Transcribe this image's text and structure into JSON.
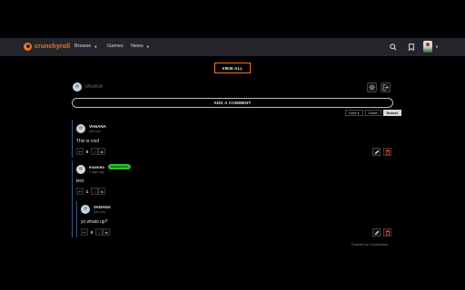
{
  "nav": {
    "logo": "crunchyroll",
    "items": [
      {
        "label": "Browse",
        "caret": true
      },
      {
        "label": "Games",
        "caret": false
      },
      {
        "label": "News",
        "caret": true
      }
    ],
    "icons": [
      "search-icon",
      "bookmark-icon",
      "avatar"
    ],
    "accent": "#f47521",
    "bg": "#23252b"
  },
  "view_all": "VIEW ALL",
  "composer": {
    "username": "VANANA",
    "add_comment": "ADD A COMMENT",
    "icons": [
      "gear-icon",
      "logout-icon"
    ]
  },
  "sort": {
    "options": [
      "Votes ▾",
      "Oldest",
      "Newest"
    ],
    "active": "Newest"
  },
  "comments": [
    {
      "username": "VANANA",
      "time": "just now",
      "text": "This is cool",
      "votes": "0",
      "badge": ""
    },
    {
      "username": "evanmo",
      "time": "2 days ago",
      "text": "test",
      "votes": "1",
      "badge": "MODERATOR",
      "replies": [
        {
          "username": "VANANA",
          "time": "just now",
          "text": "yo whats up?",
          "votes": "0"
        }
      ]
    }
  ],
  "footer": "Powered by Commentano"
}
